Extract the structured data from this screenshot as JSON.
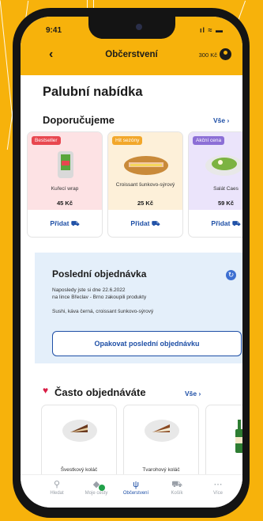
{
  "status_bar": {
    "time": "9:41",
    "icons": "ıl ≈ ▬"
  },
  "header": {
    "back": "‹",
    "title": "Občerstvení",
    "credit": "300 Kč"
  },
  "page_title": "Palubní nabídka",
  "recommended": {
    "title": "Doporučujeme",
    "see_all": "Vše ›",
    "items": [
      {
        "badge": "Bestseller",
        "badge_color": "#e8474f",
        "top_color": "#fde2e4",
        "name": "Kuřecí wrap",
        "price": "45 Kč",
        "add": "Přidat"
      },
      {
        "badge": "Hit sezóny",
        "badge_color": "#f2a72a",
        "top_color": "#fdf0d9",
        "name": "Croissant šunkovo-sýrový",
        "price": "25 Kč",
        "add": "Přidat"
      },
      {
        "badge": "Akční cena",
        "badge_color": "#8c6fd6",
        "top_color": "#ebe4fb",
        "name": "Salát Caes",
        "price": "59 Kč",
        "add": "Přidat"
      }
    ]
  },
  "last_order": {
    "title": "Poslední objednávka",
    "line1": "Naposledy jste si dne 22.6.2022",
    "line2": "na lince Břeclav - Brno zakoupili produkty",
    "products": "Sushi, káva černá, croissant šunkovo-sýrový",
    "button": "Opakovat poslední objednávku"
  },
  "frequent": {
    "title": "Často objednáváte",
    "see_all": "Vše ›",
    "items": [
      {
        "name": "Švestkový koláč"
      },
      {
        "name": "Tvarohový koláč"
      },
      {
        "name": ""
      }
    ]
  },
  "tabbar": [
    {
      "label": "Hledat",
      "icon": "search-icon",
      "glyph": "⚲"
    },
    {
      "label": "Moje cesty",
      "icon": "ticket-icon",
      "glyph": "◆"
    },
    {
      "label": "Občerstvení",
      "icon": "food-icon",
      "glyph": "ψ"
    },
    {
      "label": "Košík",
      "icon": "cart-icon",
      "glyph": "⛟"
    },
    {
      "label": "Více",
      "icon": "more-icon",
      "glyph": "⋯"
    }
  ],
  "colors": {
    "brand_yellow": "#F7B20B",
    "accent_blue": "#1e4fa6"
  }
}
